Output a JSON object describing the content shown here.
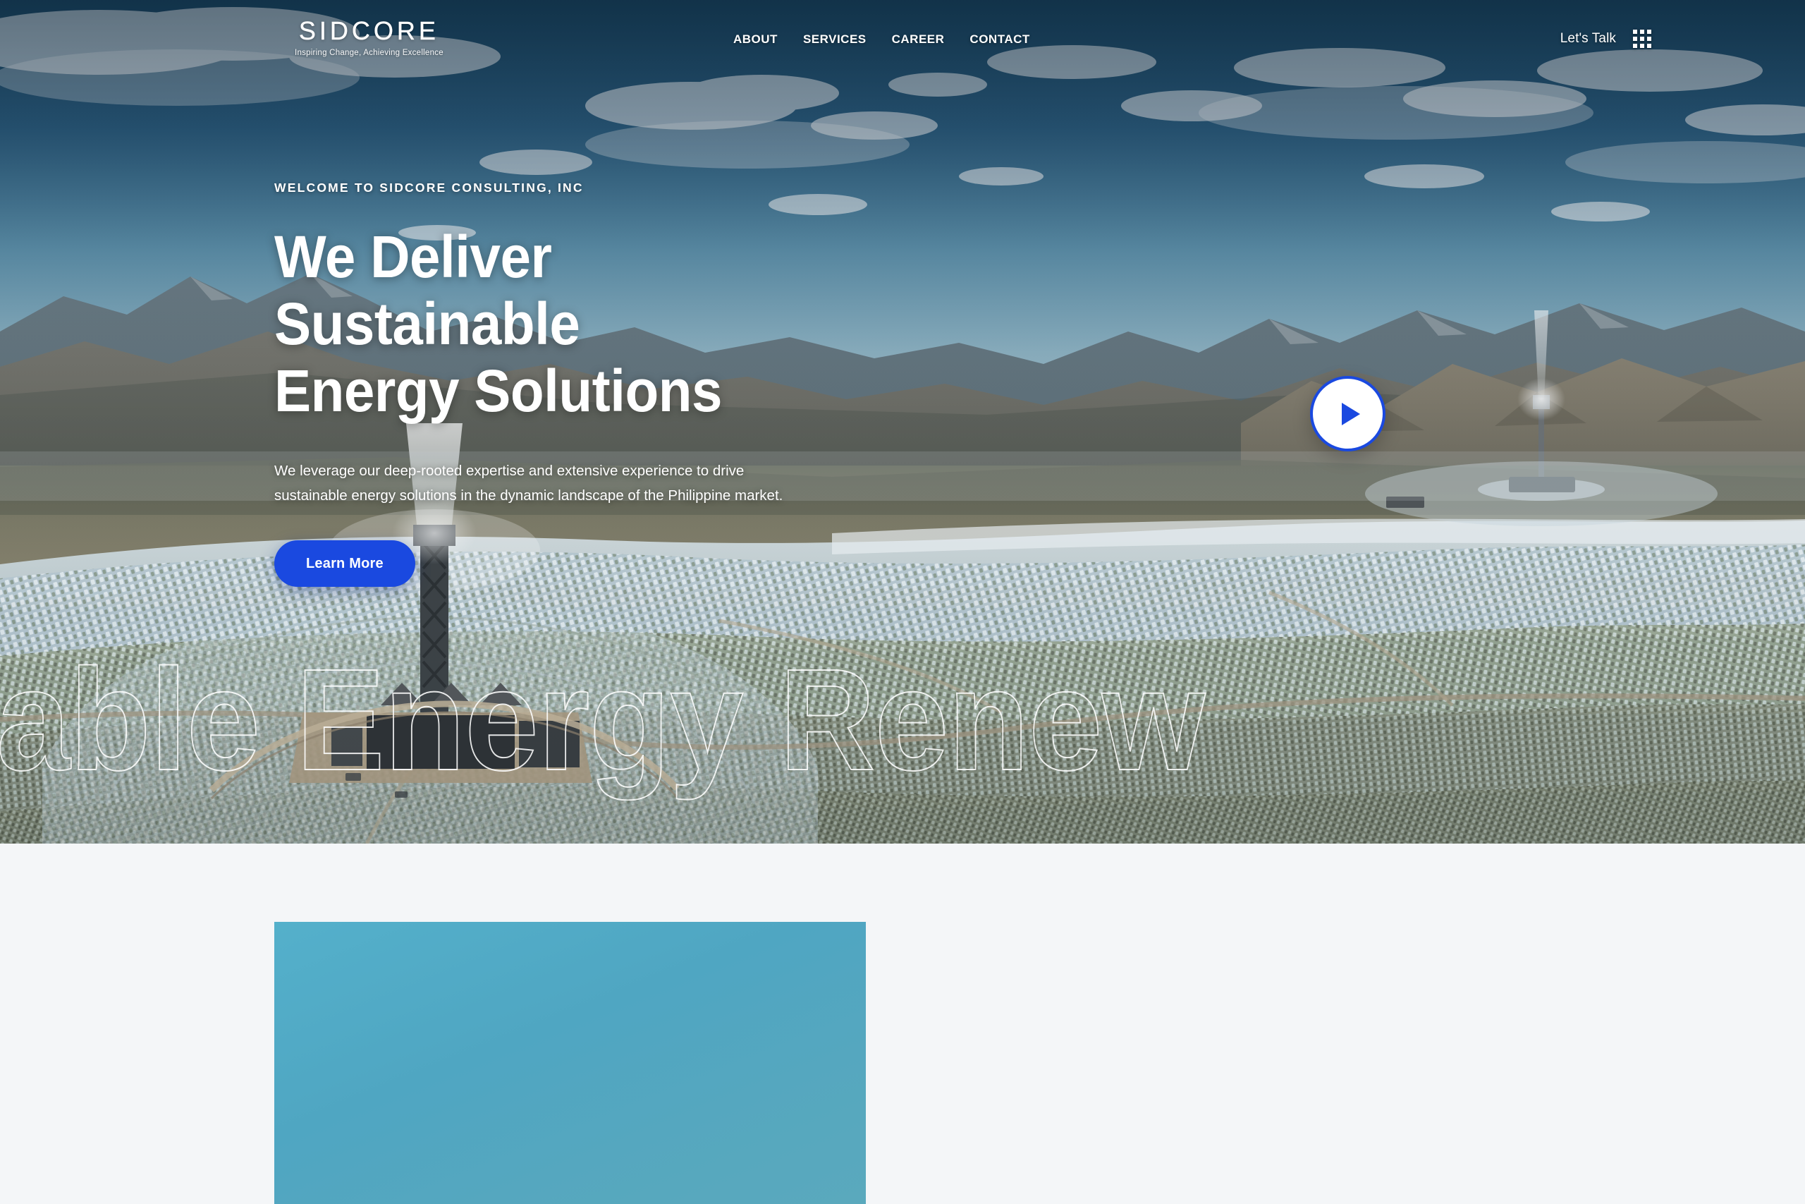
{
  "brand": {
    "logo_text": "SIDCORE",
    "tagline": "Inspiring Change, Achieving Excellence"
  },
  "header": {
    "nav": [
      {
        "label": "ABOUT",
        "name": "nav-item-about"
      },
      {
        "label": "SERVICES",
        "name": "nav-item-services"
      },
      {
        "label": "CAREER",
        "name": "nav-item-career"
      },
      {
        "label": "CONTACT",
        "name": "nav-item-contact"
      }
    ],
    "cta_label": "Let's Talk",
    "menu_icon": "grid-menu-icon"
  },
  "hero": {
    "eyebrow": "WELCOME TO SIDCORE CONSULTING, INC",
    "headline_line1": "We Deliver Sustainable",
    "headline_line2": "Energy Solutions",
    "paragraph": "We leverage our deep-rooted expertise and extensive experience to drive sustainable energy solutions in the dynamic landscape of the Philippine market.",
    "button_label": "Learn More",
    "play_icon": "play-icon",
    "marquee_text": "ewable Energy Renew",
    "marquee_phrase": "Renewable Energy",
    "background_description": "Aerial photograph of a concentrated solar power tower plant with heliostat mirror field, desert salt flats and mountains under a blue cloudy sky"
  },
  "colors": {
    "accent_blue": "#1a49e0",
    "hero_sky": "#2d6184",
    "section_background": "#f4f6f8",
    "card_teal": "#4fa6c2"
  },
  "section_below": {
    "card_name": "media-card"
  }
}
